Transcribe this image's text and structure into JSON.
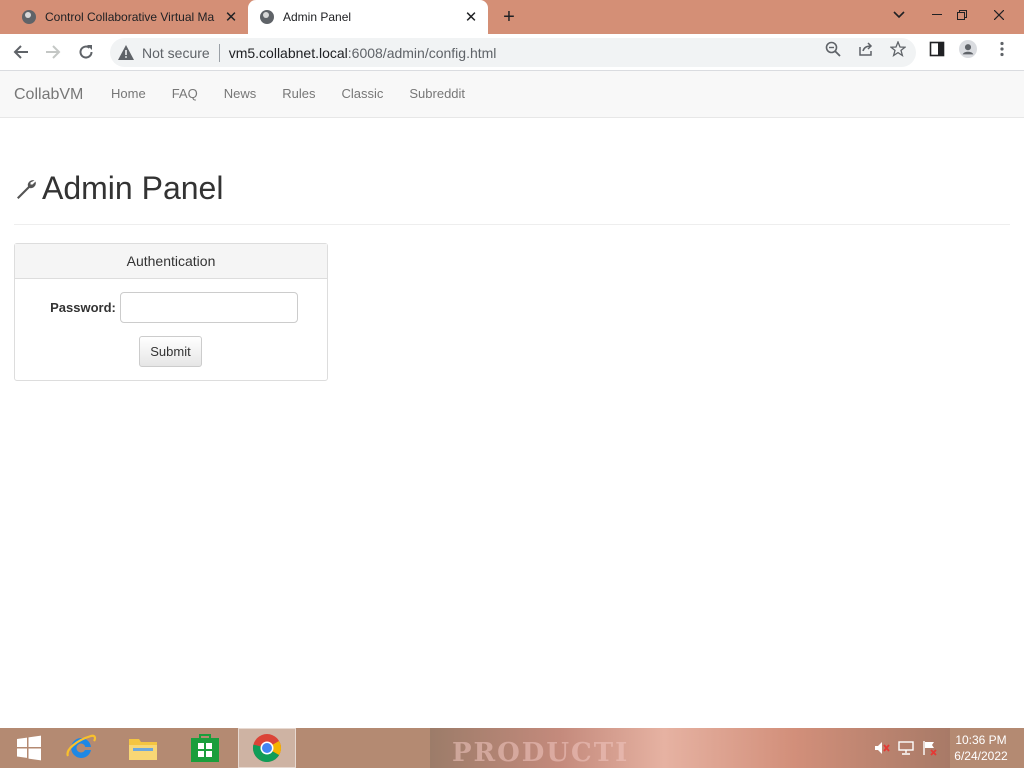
{
  "browser": {
    "tabs": [
      {
        "title": "Control Collaborative Virtual Ma",
        "active": false
      },
      {
        "title": "Admin Panel",
        "active": true
      }
    ],
    "new_tab_label": "+",
    "address": {
      "security_label": "Not secure",
      "host": "vm5.collabnet.local",
      "path": ":6008/admin/config.html"
    }
  },
  "navbar": {
    "brand": "CollabVM",
    "links": [
      "Home",
      "FAQ",
      "News",
      "Rules",
      "Classic",
      "Subreddit"
    ]
  },
  "page": {
    "title": "Admin Panel",
    "panel": {
      "heading": "Authentication",
      "password_label": "Password:",
      "password_value": "",
      "submit_label": "Submit"
    }
  },
  "taskbar": {
    "wallpaper_text": "PRODUCTI",
    "clock_time": "10:36 PM",
    "clock_date": "6/24/2022"
  },
  "colors": {
    "tabstrip": "#d48f76",
    "navbar_bg": "#f8f8f8",
    "taskbar": "#b48a72"
  }
}
